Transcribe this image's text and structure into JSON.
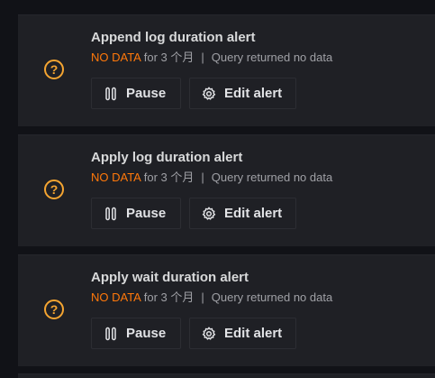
{
  "alerts": [
    {
      "title": "Append log duration alert",
      "state": "NO DATA",
      "duration": "for 3 个月",
      "separator": "|",
      "message": "Query returned no data",
      "pause_label": "Pause",
      "edit_label": "Edit alert"
    },
    {
      "title": "Apply log duration alert",
      "state": "NO DATA",
      "duration": "for 3 个月",
      "separator": "|",
      "message": "Query returned no data",
      "pause_label": "Pause",
      "edit_label": "Edit alert"
    },
    {
      "title": "Apply wait duration alert",
      "state": "NO DATA",
      "duration": "for 3 个月",
      "separator": "|",
      "message": "Query returned no data",
      "pause_label": "Pause",
      "edit_label": "Edit alert"
    }
  ],
  "icons": {
    "state_icon": "question-circle-icon",
    "state_glyph": "?",
    "pause_icon": "pause-icon",
    "edit_icon": "gear-icon"
  },
  "colors": {
    "background": "#111217",
    "card": "#1f2025",
    "no_data": "#ff780a",
    "state_icon": "#f5a531",
    "title": "#d8d9da",
    "meta": "#9fa0a5"
  }
}
